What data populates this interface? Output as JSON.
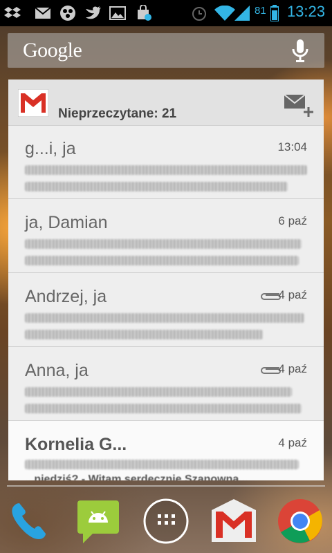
{
  "status_bar": {
    "left_icons": [
      "dropbox-icon",
      "gmail-notification-icon",
      "bbm-icon",
      "twitter-icon",
      "gallery-icon",
      "store-update-icon"
    ],
    "battery_level": "81",
    "time": "13:23",
    "colors": {
      "accent": "#33b5e5"
    }
  },
  "search": {
    "logo": "Google"
  },
  "widget": {
    "unread_label": "Nieprzeczytane: 21",
    "messages": [
      {
        "sender": "g...i, ja",
        "date": "13:04",
        "attachment": false,
        "unread": false
      },
      {
        "sender": "ja, Damian",
        "date": "6 paź",
        "attachment": false,
        "unread": false
      },
      {
        "sender": "Andrzej, ja",
        "date": "4 paź",
        "attachment": true,
        "unread": false
      },
      {
        "sender": "Anna, ja",
        "date": "4 paź",
        "attachment": true,
        "unread": false
      },
      {
        "sender": "Kornelia G...",
        "date": "4 paź",
        "attachment": false,
        "unread": true,
        "snippet_tail": "...niedziś? - Witam serdecznie Szanowna..."
      }
    ]
  },
  "dock": {
    "items": [
      "phone-icon",
      "messaging-icon",
      "app-drawer-icon",
      "gmail-icon",
      "chrome-icon"
    ]
  }
}
